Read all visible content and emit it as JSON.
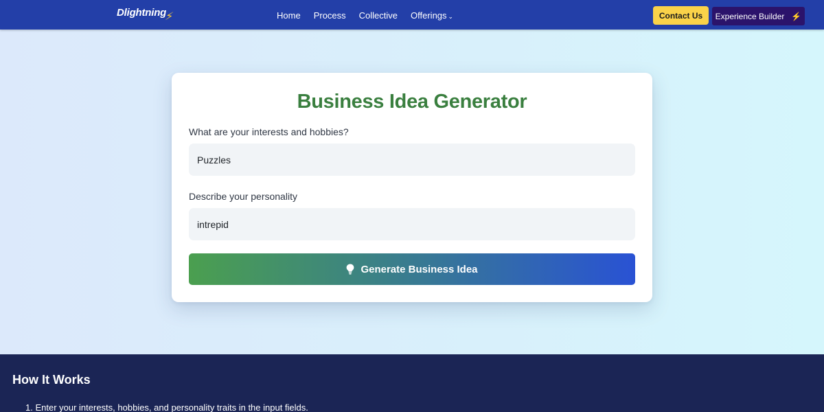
{
  "nav": {
    "logo": "Dlightning",
    "logo_bolt": "⚡",
    "links": [
      "Home",
      "Process",
      "Collective",
      "Offerings"
    ],
    "offerings_chevron": "⌄",
    "contact_label": "Contact Us",
    "builder_label": "Experience Builder",
    "builder_icon": "⚡"
  },
  "card": {
    "title": "Business Idea Generator",
    "interests_label": "What are your interests and hobbies?",
    "interests_value": "Puzzles",
    "personality_label": "Describe your personality",
    "personality_value": "intrepid",
    "button_label": "Generate Business Idea"
  },
  "how": {
    "title": "How It Works",
    "steps": [
      "1. Enter your interests, hobbies, and personality traits in the input fields."
    ]
  },
  "colors": {
    "nav_bg": "#233fa8",
    "title_green": "#3a7f3f",
    "contact_bg": "#fad249",
    "builder_bg": "#2b136b",
    "footer_bg": "#1b2555"
  }
}
